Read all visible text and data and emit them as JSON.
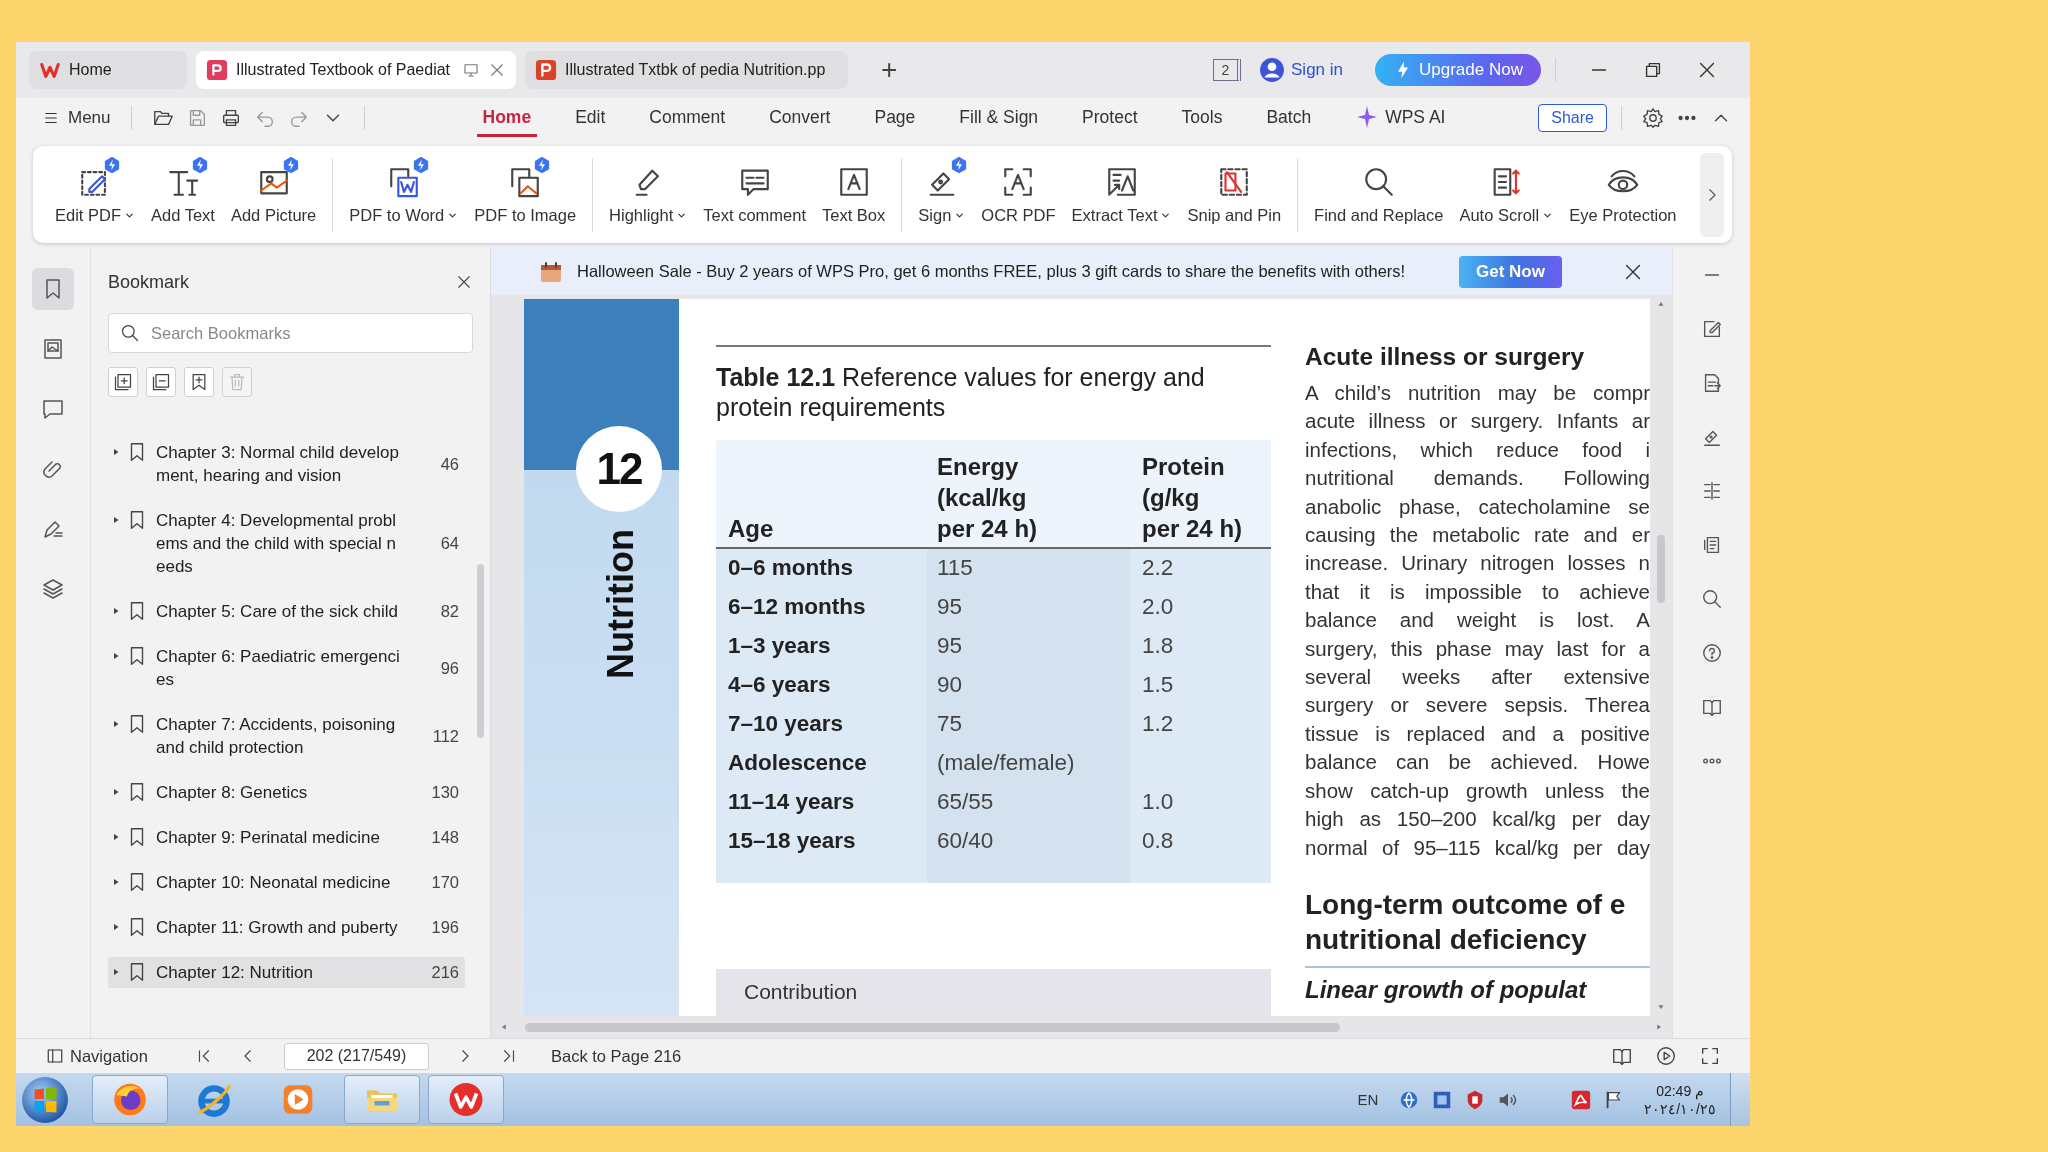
{
  "tabs": [
    {
      "kind": "home",
      "label": "Home",
      "selected": false
    },
    {
      "kind": "pdf",
      "label": "Illustrated Textbook of Paediat",
      "selected": true
    },
    {
      "kind": "ppt",
      "label": "Illustrated Txtbk of pedia Nutrition.pp",
      "selected": false
    }
  ],
  "new_tab": "+",
  "title_bar": {
    "window_count": "2",
    "sign_in": "Sign in",
    "upgrade": "Upgrade Now"
  },
  "menu": {
    "label": "Menu",
    "tabs": [
      {
        "label": "Home",
        "selected": true
      },
      {
        "label": "Edit",
        "selected": false
      },
      {
        "label": "Comment",
        "selected": false
      },
      {
        "label": "Convert",
        "selected": false
      },
      {
        "label": "Page",
        "selected": false
      },
      {
        "label": "Fill & Sign",
        "selected": false
      },
      {
        "label": "Protect",
        "selected": false
      },
      {
        "label": "Tools",
        "selected": false
      },
      {
        "label": "Batch",
        "selected": false
      },
      {
        "label": "WPS AI",
        "selected": false,
        "kind": "ai"
      }
    ],
    "share": "Share"
  },
  "ribbon": [
    [
      {
        "label": "Edit PDF",
        "dropdown": true,
        "badge": true
      },
      {
        "label": "Add Text",
        "dropdown": false,
        "badge": true
      },
      {
        "label": "Add Picture",
        "dropdown": false,
        "badge": true
      }
    ],
    [
      {
        "label": "PDF to Word",
        "dropdown": true,
        "badge": true
      },
      {
        "label": "PDF to Image",
        "dropdown": false,
        "badge": true
      }
    ],
    [
      {
        "label": "Highlight",
        "dropdown": true,
        "badge": false
      },
      {
        "label": "Text comment",
        "dropdown": false,
        "badge": false
      },
      {
        "label": "Text Box",
        "dropdown": false,
        "badge": false
      }
    ],
    [
      {
        "label": "Sign",
        "dropdown": true,
        "badge": true
      },
      {
        "label": "OCR PDF",
        "dropdown": false,
        "badge": false
      },
      {
        "label": "Extract Text",
        "dropdown": true,
        "badge": false
      },
      {
        "label": "Snip and Pin",
        "dropdown": false,
        "badge": false
      }
    ],
    [
      {
        "label": "Find and Replace",
        "dropdown": false,
        "badge": false
      },
      {
        "label": "Auto Scroll",
        "dropdown": true,
        "badge": false
      },
      {
        "label": "Eye Protection",
        "dropdown": false,
        "badge": false
      }
    ]
  ],
  "left_rail": [
    {
      "selected": true
    },
    {
      "selected": false
    },
    {
      "selected": false
    },
    {
      "selected": false
    },
    {
      "selected": false
    },
    {
      "selected": false
    }
  ],
  "bookmark_panel": {
    "title": "Bookmark",
    "search": {
      "placeholder": "Search Bookmarks"
    },
    "tools": [
      {
        "disabled": false
      },
      {
        "disabled": false
      },
      {
        "disabled": false
      },
      {
        "disabled": true
      }
    ],
    "items": [
      {
        "label": "Chapter 3: Normal child development, hearing and vision",
        "page": "46",
        "selected": false
      },
      {
        "label": "Chapter 4: Developmental problems and the child with special needs",
        "page": "64",
        "selected": false
      },
      {
        "label": "Chapter 5: Care of the sick child",
        "page": "82",
        "selected": false
      },
      {
        "label": "Chapter 6: Paediatric emergencies",
        "page": "96",
        "selected": false
      },
      {
        "label": "Chapter 7: Accidents, poisoning and child protection",
        "page": "112",
        "selected": false
      },
      {
        "label": "Chapter 8: Genetics",
        "page": "130",
        "selected": false
      },
      {
        "label": "Chapter 9: Perinatal medicine",
        "page": "148",
        "selected": false
      },
      {
        "label": "Chapter 10: Neonatal medicine",
        "page": "170",
        "selected": false
      },
      {
        "label": "Chapter 11: Growth and puberty",
        "page": "196",
        "selected": false
      },
      {
        "label": "Chapter 12: Nutrition",
        "page": "216",
        "selected": true
      }
    ]
  },
  "banner": {
    "text": "Halloween Sale - Buy 2 years of WPS Pro, get 6 months FREE, plus 3 gift cards to share the benefits with others!",
    "button": "Get Now"
  },
  "page": {
    "chapter_number": "12",
    "chapter_title": "Nutrition",
    "table": {
      "caption": "**Table 12.1**  Reference values for energy and protein requirements",
      "columns": [
        [
          "Age"
        ],
        [
          "Energy",
          "(kcal/kg",
          "per 24 h)"
        ],
        [
          "Protein",
          "(g/kg",
          "per 24 h)"
        ]
      ],
      "rows": [
        {
          "age": "0–6 months",
          "energy": "115",
          "protein": "2.2"
        },
        {
          "age": "6–12 months",
          "energy": "95",
          "protein": "2.0"
        },
        {
          "age": "1–3 years",
          "energy": "95",
          "protein": "1.8"
        },
        {
          "age": "4–6 years",
          "energy": "90",
          "protein": "1.5"
        },
        {
          "age": "7–10 years",
          "energy": "75",
          "protein": "1.2"
        },
        {
          "age": "Adolescence",
          "energy": "(male/female)"
        },
        {
          "age": "11–14 years",
          "energy": "65/55",
          "protein": "1.0"
        },
        {
          "age": "15–18 years",
          "energy": "60/40",
          "protein": "0.8"
        }
      ]
    },
    "box_title": "Contribution",
    "section_heading": "Acute illness or surgery",
    "paragraph_lines": [
      "A child’s nutrition may be compr",
      "acute illness or surgery. Infants ar",
      "infections, which reduce food i",
      "nutritional demands. Following",
      "anabolic phase, catecholamine se",
      "causing the metabolic rate and er",
      "increase. Urinary nitrogen losses n",
      "that it is impossible to achieve",
      "balance and weight is lost. A",
      "surgery, this phase may last for a",
      "several weeks after extensive",
      "surgery or severe sepsis. Therea",
      "tissue is replaced and a positive",
      "balance can be achieved. Howe",
      "show catch-up growth unless the",
      "high as 150–200 kcal/kg per day",
      "normal of 95–115 kcal/kg per day"
    ],
    "heading_lines": [
      "Long-term outcome of e",
      "nutritional deficiency"
    ],
    "subheading": "Linear growth of populat"
  },
  "status_bar": {
    "navigation": "Navigation",
    "page_field": "202 (217/549)",
    "back_link": "Back to Page 216"
  },
  "taskbar": {
    "apps": [
      {
        "kind": "start",
        "running": false
      },
      {
        "kind": "firefox",
        "running": true
      },
      {
        "kind": "ie",
        "running": false
      },
      {
        "kind": "media",
        "running": false
      },
      {
        "kind": "folder",
        "running": true
      },
      {
        "kind": "wps",
        "running": true
      }
    ],
    "language": "EN",
    "time": "02:49 م",
    "date": "٢٠٢٤/١٠/٢٥"
  }
}
